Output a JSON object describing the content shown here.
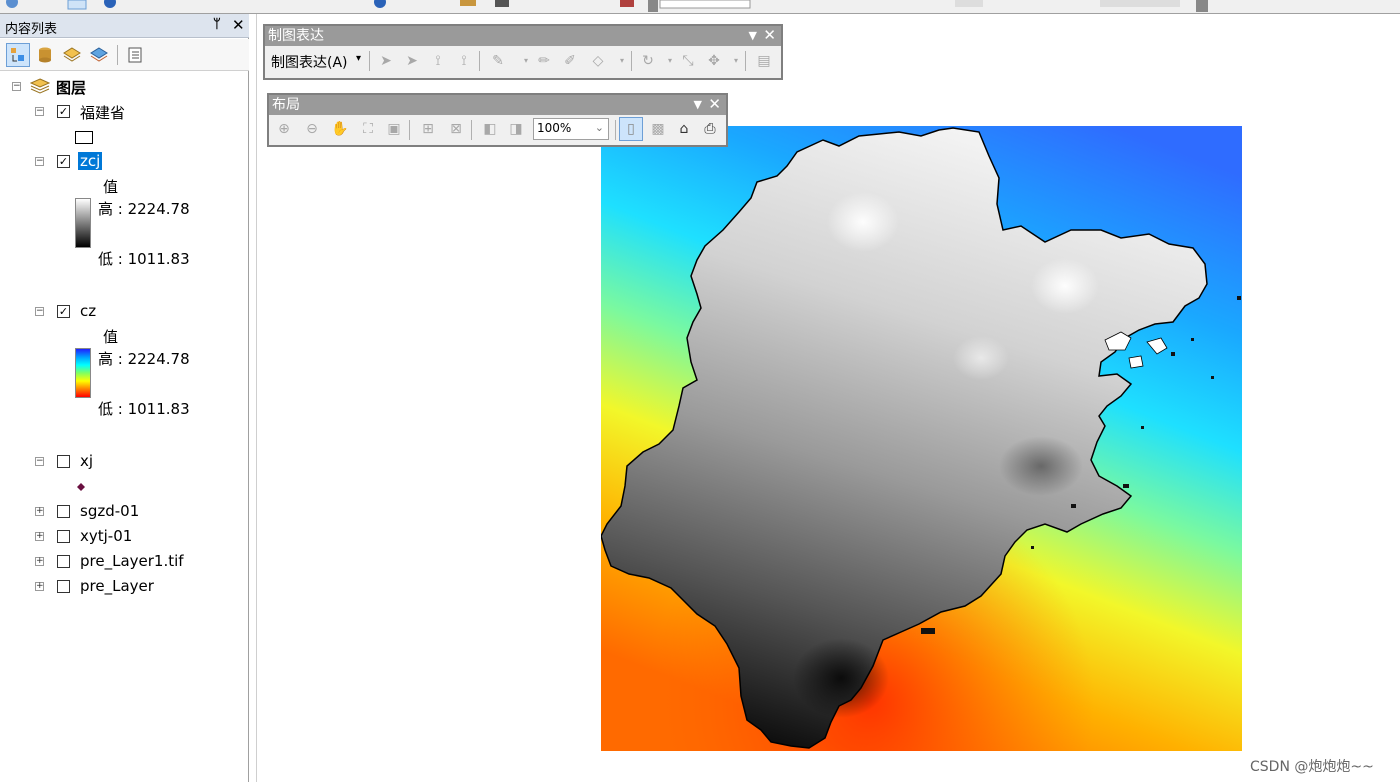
{
  "toc": {
    "title": "内容列表",
    "pin_glyph": "ᛘ",
    "close_glyph": "✕",
    "root_label": "图层",
    "layers": [
      {
        "name": "福建省",
        "checked": true
      },
      {
        "name": "zcj",
        "checked": true,
        "selected": true,
        "legend_heading": "值",
        "high_label": "高 : 2224.78",
        "low_label": "低 : 1011.83"
      },
      {
        "name": "cz",
        "checked": true,
        "legend_heading": "值",
        "high_label": "高 : 2224.78",
        "low_label": "低 : 1011.83"
      },
      {
        "name": "xj",
        "checked": false
      },
      {
        "name": "sgzd-01",
        "checked": false
      },
      {
        "name": "xytj-01",
        "checked": false
      },
      {
        "name": "pre_Layer1.tif",
        "checked": false
      },
      {
        "name": "pre_Layer",
        "checked": false
      }
    ]
  },
  "toolbars": {
    "representation": {
      "title": "制图表达",
      "menu_label": "制图表达(A)",
      "close_glyph": "✕"
    },
    "layout": {
      "title": "布局",
      "zoom_value": "100%",
      "close_glyph": "✕"
    }
  },
  "watermark": "CSDN @炮炮炮~~",
  "colors": {
    "selection": "#0078d7",
    "toolbar_header": "#9a9a9a",
    "panel_header": "#dde4ee"
  }
}
